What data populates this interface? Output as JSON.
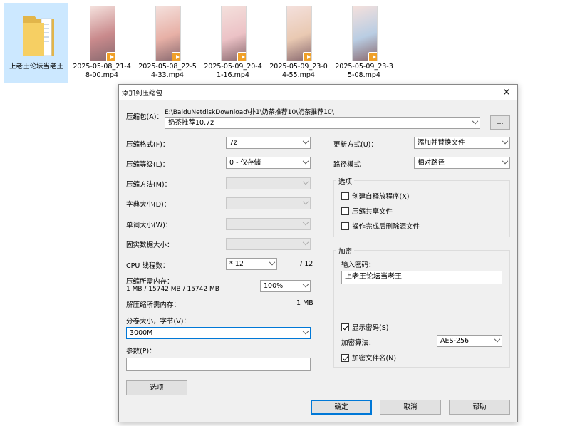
{
  "desktop": {
    "folder": {
      "name": "上老王论坛当老王"
    },
    "files": [
      {
        "name": "2025-05-08_21-48-00.mp4",
        "tint": "#c98a8c"
      },
      {
        "name": "2025-05-08_22-54-33.mp4",
        "tint": "#e7b0a6"
      },
      {
        "name": "2025-05-09_20-41-16.mp4",
        "tint": "#ecc2c6"
      },
      {
        "name": "2025-05-09_23-04-55.mp4",
        "tint": "#e9c9b2"
      },
      {
        "name": "2025-05-09_23-35-08.mp4",
        "tint": "#b9cde3"
      }
    ]
  },
  "dialog": {
    "title": "添加到压缩包",
    "archive_label": "压缩包(A)：",
    "archive_path": "E:\\BaiduNetdiskDownload\\扑1\\奶茶推荐10\\奶茶推荐10\\",
    "archive_name": "奶茶推荐10.7z",
    "browse_label": "...",
    "left": {
      "format_label": "压缩格式(F)：",
      "format_value": "7z",
      "level_label": "压缩等级(L)：",
      "level_value": "0 - 仅存储",
      "method_label": "压缩方法(M)：",
      "dict_label": "字典大小(D)：",
      "word_label": "单词大小(W)：",
      "solid_label": "固实数据大小：",
      "cpu_label": "CPU 线程数：",
      "cpu_value": "* 12",
      "cpu_total": "/ 12",
      "mem_label": "压缩所需内存：",
      "mem_value": "1 MB / 15742 MB / 15742 MB",
      "mem_percent": "100%",
      "decomp_label": "解压缩所需内存：",
      "decomp_value": "1 MB",
      "split_label": "分卷大小，字节(V)：",
      "split_value": "3000M",
      "params_label": "参数(P)：",
      "params_value": "",
      "options_button": "选项"
    },
    "right": {
      "update_label": "更新方式(U)：",
      "update_value": "添加并替换文件",
      "path_label": "路径模式",
      "path_value": "相对路径",
      "options_group": "选项",
      "opt_sfx": "创建自释放程序(X)",
      "opt_shared": "压缩共享文件",
      "opt_delete": "操作完成后删除源文件",
      "encrypt_group": "加密",
      "password_label": "输入密码：",
      "password_value": "上老王论坛当老王",
      "show_password": "显示密码(S)",
      "enc_method_label": "加密算法：",
      "enc_method_value": "AES-256",
      "encrypt_names": "加密文件名(N)"
    },
    "buttons": {
      "ok": "确定",
      "cancel": "取消",
      "help": "帮助"
    }
  }
}
